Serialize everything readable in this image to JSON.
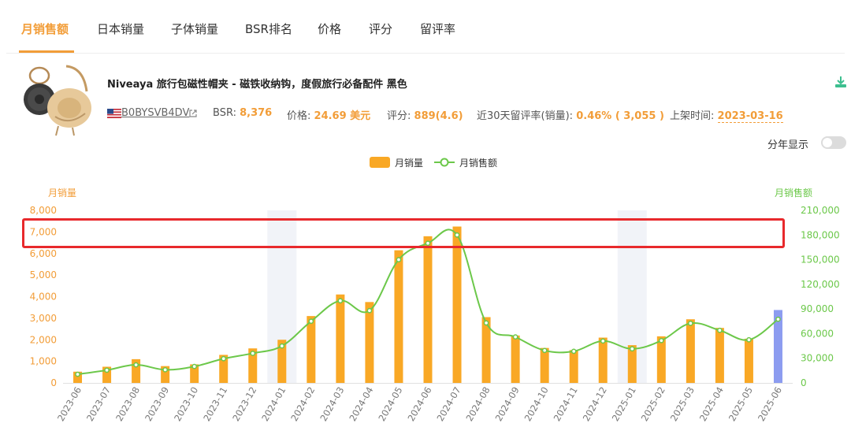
{
  "tabs": [
    "月销售额",
    "日本销量",
    "子体销量",
    "BSR排名",
    "价格",
    "评分",
    "留评率"
  ],
  "product": {
    "title": "Niveaya 旅行包磁性帽夹 - 磁铁收纳钩，度假旅行必备配件 黑色",
    "asin": "B0BYSVB4DV",
    "bsr_label": "BSR:",
    "bsr_value": "8,376",
    "price_label": "价格:",
    "price_value": "24.69 美元",
    "rating_label": "评分:",
    "rating_value": "889(4.6)",
    "review_rate_label": "近30天留评率(销量):",
    "review_rate_value": "0.46% ( 3,055 )",
    "listed_label": "上架时间:",
    "listed_value": "2023-03-16"
  },
  "controls": {
    "year_split_label": "分年显示",
    "year_split_on": false
  },
  "colors": {
    "accent": "#f29d38",
    "bar": "#f9a825",
    "bar_highlight": "#8c9cf0",
    "line": "#6cc84a",
    "highlight_box": "#e8292c"
  },
  "chart_data": {
    "type": "bar",
    "legend": [
      "月销量",
      "月销售额"
    ],
    "legend_placement": "top-center",
    "ylabel": "月销量",
    "y2label": "月销售额",
    "ylim": [
      0,
      8000
    ],
    "y2lim": [
      0,
      210000
    ],
    "yticks": [
      "0",
      "1,000",
      "2,000",
      "3,000",
      "4,000",
      "5,000",
      "6,000",
      "7,000",
      "8,000"
    ],
    "y2ticks": [
      "0",
      "30,000",
      "60,000",
      "90,000",
      "120,000",
      "150,000",
      "180,000",
      "210,000"
    ],
    "categories": [
      "2023-06",
      "2023-07",
      "2023-08",
      "2023-09",
      "2023-10",
      "2023-11",
      "2023-12",
      "2024-01",
      "2024-02",
      "2024-03",
      "2024-04",
      "2024-05",
      "2024-06",
      "2024-07",
      "2024-08",
      "2024-09",
      "2024-10",
      "2024-11",
      "2024-12",
      "2025-01",
      "2025-02",
      "2025-03",
      "2025-04",
      "2025-05",
      "2025-06"
    ],
    "shaded_categories": [
      "2024-01",
      "2025-01"
    ],
    "highlighted_category": "2025-06",
    "series": [
      {
        "name": "月销量",
        "type": "bar",
        "axis": "left",
        "values": [
          520,
          750,
          1100,
          780,
          860,
          1300,
          1600,
          2000,
          3100,
          4100,
          3750,
          6150,
          6800,
          7250,
          3050,
          2200,
          1620,
          1520,
          2100,
          1750,
          2160,
          2950,
          2550,
          2050,
          3380
        ]
      },
      {
        "name": "月销售额",
        "type": "line",
        "axis": "right",
        "values": [
          10500,
          15500,
          22000,
          16000,
          20000,
          29500,
          36000,
          45000,
          75000,
          100000,
          88000,
          150000,
          170000,
          180000,
          73000,
          56000,
          39500,
          38500,
          51000,
          41500,
          51500,
          72500,
          64000,
          52500,
          77500
        ]
      }
    ]
  }
}
